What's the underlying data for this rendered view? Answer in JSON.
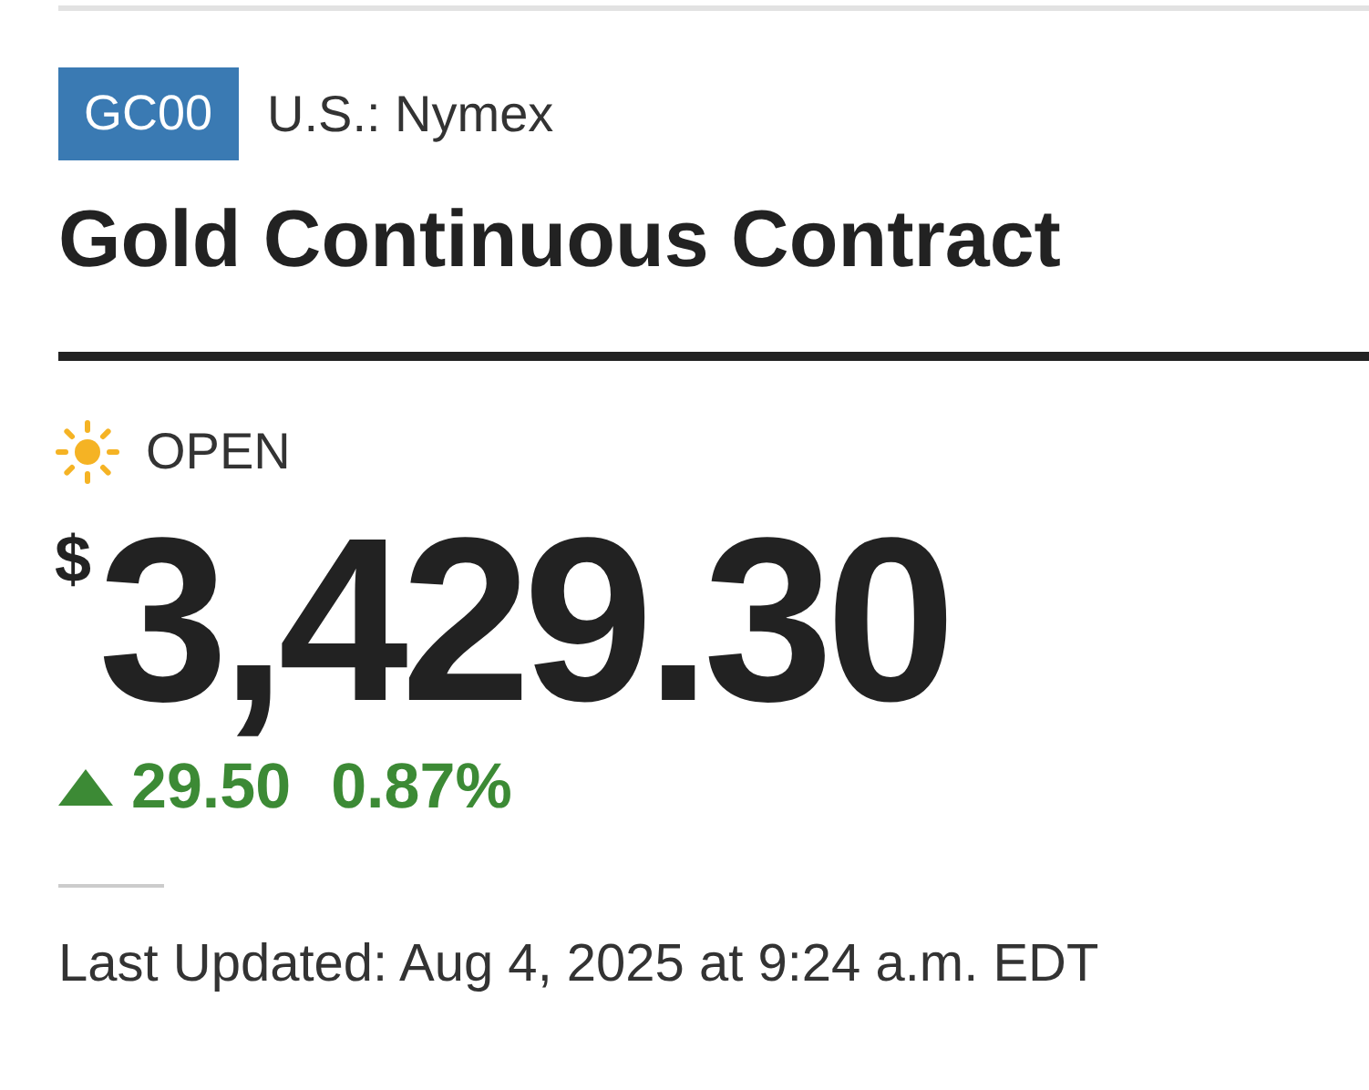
{
  "ticker": {
    "symbol": "GC00",
    "exchange": "U.S.: Nymex"
  },
  "title": "Gold Continuous Contract",
  "market_status": {
    "label": "OPEN",
    "open": true
  },
  "price": {
    "currency": "$",
    "value": "3,429.30"
  },
  "change": {
    "up": true,
    "amount": "29.50",
    "percent": "0.87%"
  },
  "last_updated": "Last Updated: Aug 4, 2025 at 9:24 a.m. EDT"
}
